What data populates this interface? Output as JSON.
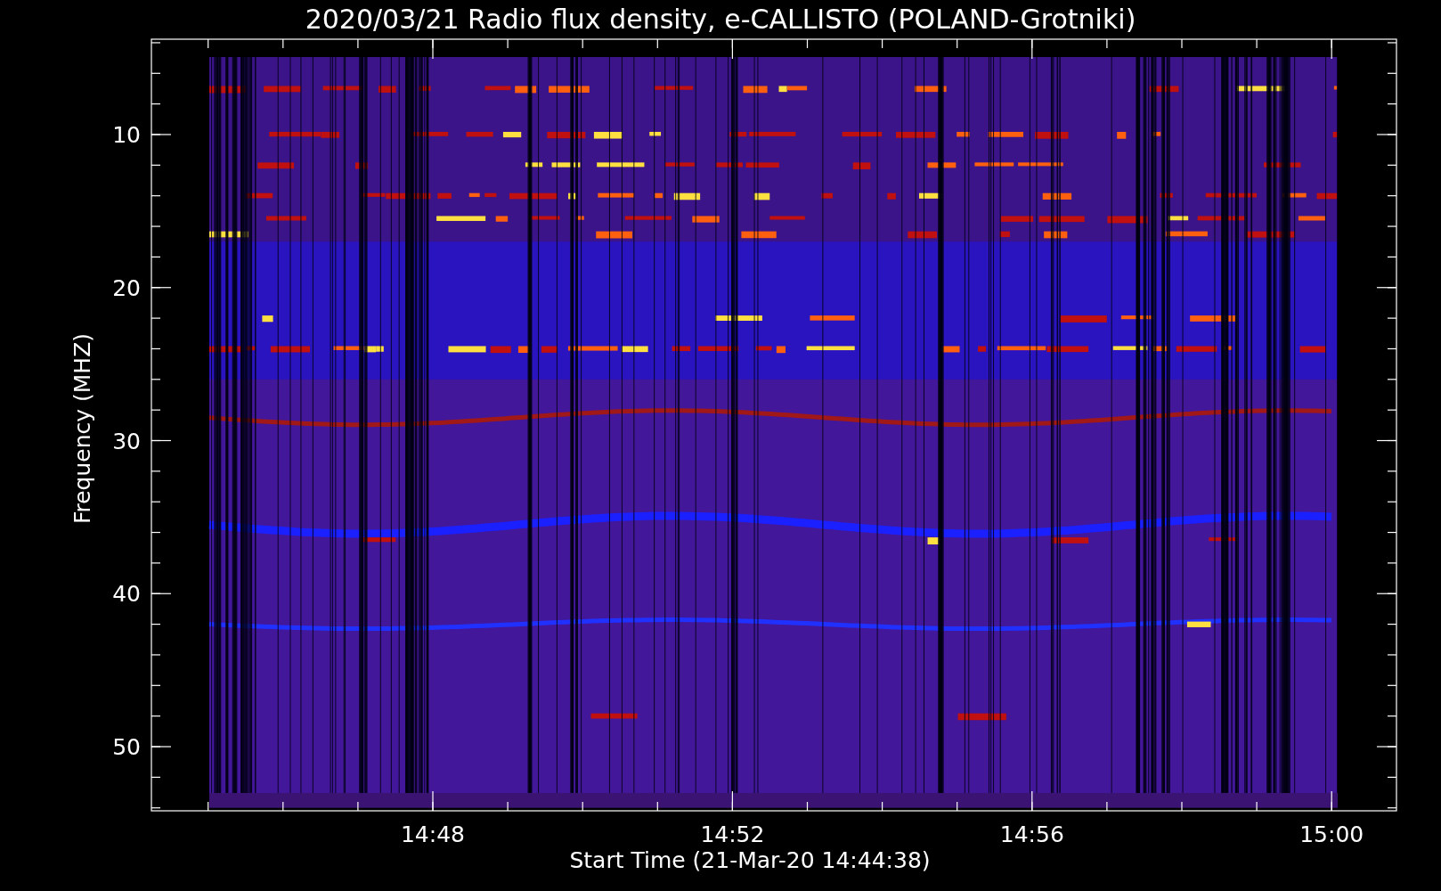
{
  "plot": {
    "title": "2020/03/21  Radio flux density, e-CALLISTO (POLAND-Grotniki)",
    "xlabel": "Start Time (21-Mar-20 14:44:38)",
    "ylabel": "Frequency (MHZ)",
    "xtick_labels": [
      "14:48",
      "14:52",
      "14:56",
      "15:00"
    ],
    "ytick_labels": [
      "10",
      "20",
      "30",
      "40",
      "50"
    ]
  }
}
